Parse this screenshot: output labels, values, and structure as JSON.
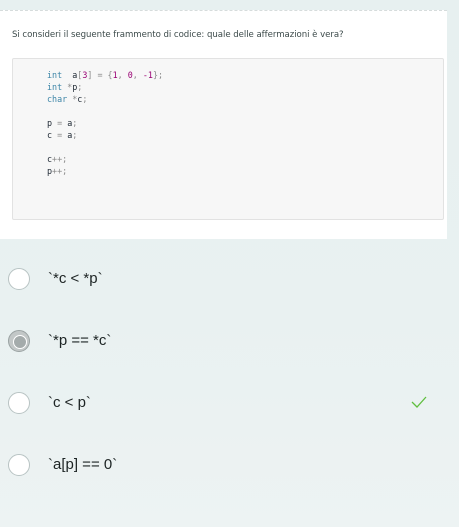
{
  "question": {
    "text": "Si consideri il seguente frammento di codice: quale delle affermazioni è vera?"
  },
  "code": {
    "line1": {
      "t1": "int",
      "t2": "a",
      "t3": "[",
      "t4": "3",
      "t5": "]",
      "t6": " = {",
      "t7": "1",
      "t8": ", ",
      "t9": "0",
      "t10": ", ",
      "t11": "-1",
      "t12": "};"
    },
    "line2": {
      "t1": "int",
      "t2": " *",
      "t3": "p",
      "t4": ";"
    },
    "line3": {
      "t1": "char",
      "t2": " *",
      "t3": "c",
      "t4": ";"
    },
    "line4": {
      "t1": "p",
      "t2": " = ",
      "t3": "a",
      "t4": ";"
    },
    "line5": {
      "t1": "c",
      "t2": " = ",
      "t3": "a",
      "t4": ";"
    },
    "line6": {
      "t1": "c",
      "t2": "++;"
    },
    "line7": {
      "t1": "p",
      "t2": "++;"
    }
  },
  "options": [
    {
      "label": "`*c < *p`",
      "selected": false,
      "correct": false
    },
    {
      "label": "`*p == *c`",
      "selected": true,
      "correct": false
    },
    {
      "label": "`c < p`",
      "selected": false,
      "correct": true
    },
    {
      "label": "`a[p] == 0`",
      "selected": false,
      "correct": false
    }
  ],
  "icons": {
    "correct_mark": "checkmark-icon"
  },
  "colors": {
    "background": "#e8f0f0",
    "check": "#5fbf3f",
    "keyword": "#3e86a8",
    "number": "#990073"
  }
}
